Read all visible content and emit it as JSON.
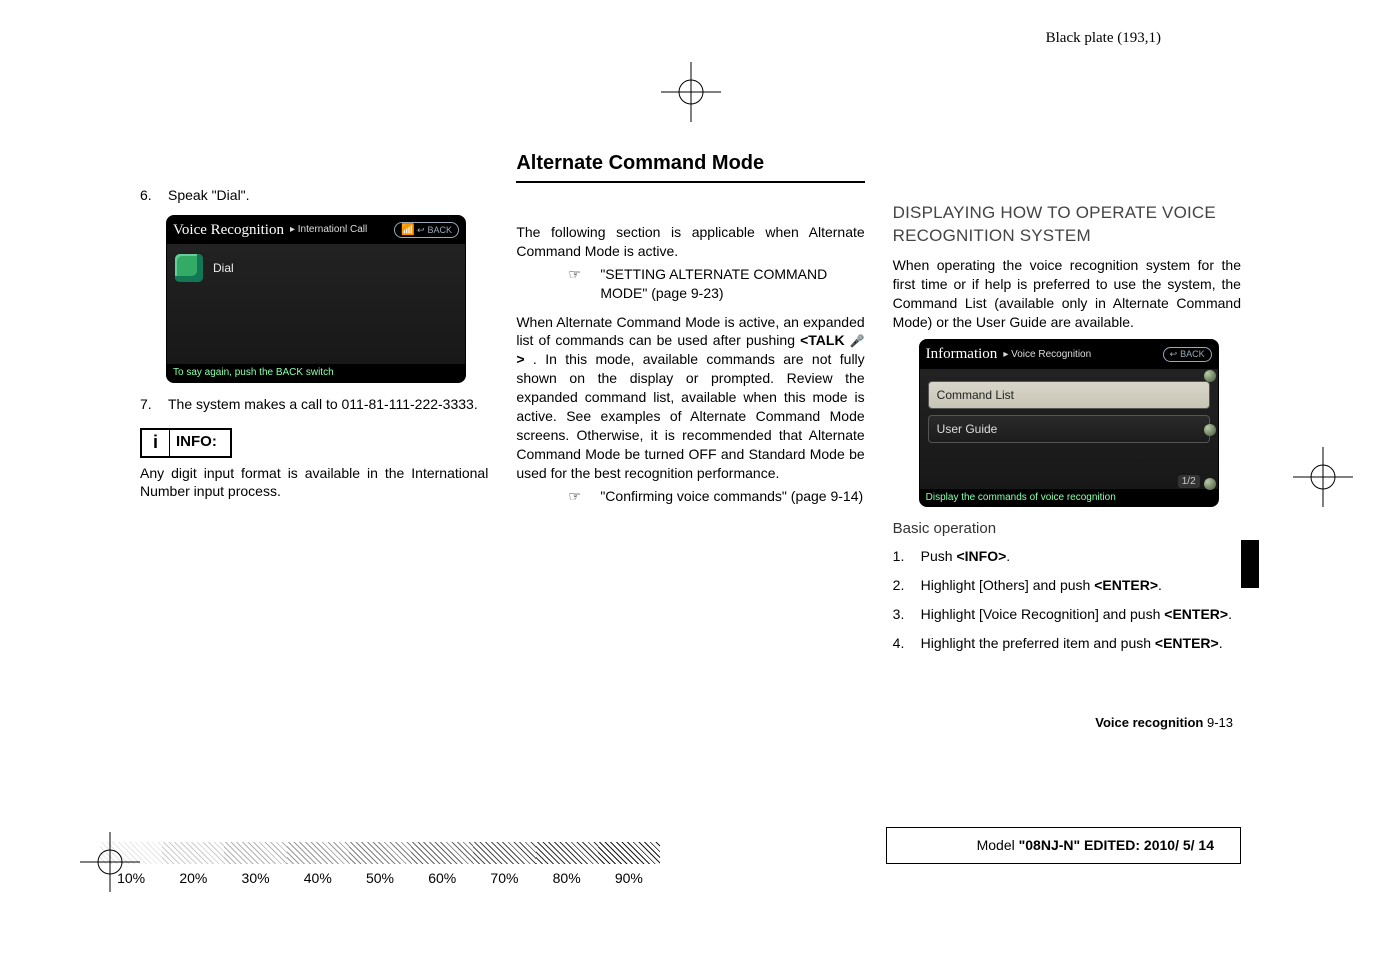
{
  "plate_label": "Black plate (193,1)",
  "columns": {
    "left": {
      "step6": {
        "num": "6.",
        "text": "Speak \"Dial\"."
      },
      "screenshot1": {
        "title_main": "Voice Recognition",
        "title_crumb": "▸ Internationl Call",
        "signal_icon": "📶",
        "back_label": "BACK",
        "list_item": "Dial",
        "footer": "To say again, push the BACK switch"
      },
      "step7": {
        "num": "7.",
        "text": "The system makes a call to 011-81-111-222-3333."
      },
      "info_label": "INFO:",
      "info_body": "Any digit input format is available in the International Number input process."
    },
    "middle": {
      "heading": "Alternate Command Mode",
      "p1": "The following section is applicable when Alternate Command Mode is active.",
      "ref1": "\"SETTING ALTERNATE COMMAND MODE\" (page 9-23)",
      "p2a": "When Alternate Command Mode is active, an expanded list of commands can be used after pushing ",
      "talk_label": "<TALK",
      "talk_icon": "🎤",
      "talk_close": " >",
      "p2b": ". In this mode, available commands are not fully shown on the display or prompted. Review the expanded command list, available when this mode is active. See examples of Alternate Command Mode screens. Otherwise, it is recommended that Alternate Command Mode be turned OFF and Standard Mode be used for the best recognition performance.",
      "ref2": "\"Confirming voice commands\" (page 9-14)"
    },
    "right": {
      "subhead": "DISPLAYING HOW TO OPERATE VOICE RECOGNITION SYSTEM",
      "p1": "When operating the voice recognition system for the first time or if help is preferred to use the system, the Command List (available only in Alternate Command Mode) or the User Guide are available.",
      "screenshot2": {
        "title_main": "Information",
        "title_crumb": "▸ Voice Recognition",
        "back_label": "BACK",
        "item1": "Command List",
        "item2": "User Guide",
        "page_indicator": "1/2",
        "footer": "Display the commands of voice recognition"
      },
      "subhead2": "Basic operation",
      "step1": {
        "num": "1.",
        "text_a": "Push ",
        "bold": "<INFO>",
        "text_b": "."
      },
      "step2": {
        "num": "2.",
        "text_a": "Highlight [Others] and push ",
        "bold": "<ENTER>",
        "text_b": "."
      },
      "step3": {
        "num": "3.",
        "text_a": "Highlight [Voice Recognition] and push ",
        "bold": "<ENTER>",
        "text_b": "."
      },
      "step4": {
        "num": "4.",
        "text_a": "Highlight the preferred item and push ",
        "bold": "<ENTER>",
        "text_b": "."
      }
    }
  },
  "footer_right": {
    "bold": "Voice recognition",
    "page": "  9-13"
  },
  "model_box": {
    "a": "Model ",
    "b": "\"08NJ-N\"",
    "c": "  EDITED:  2010/ 5/ 14"
  },
  "gradient_labels": [
    "10%",
    "20%",
    "30%",
    "40%",
    "50%",
    "60%",
    "70%",
    "80%",
    "90%"
  ]
}
